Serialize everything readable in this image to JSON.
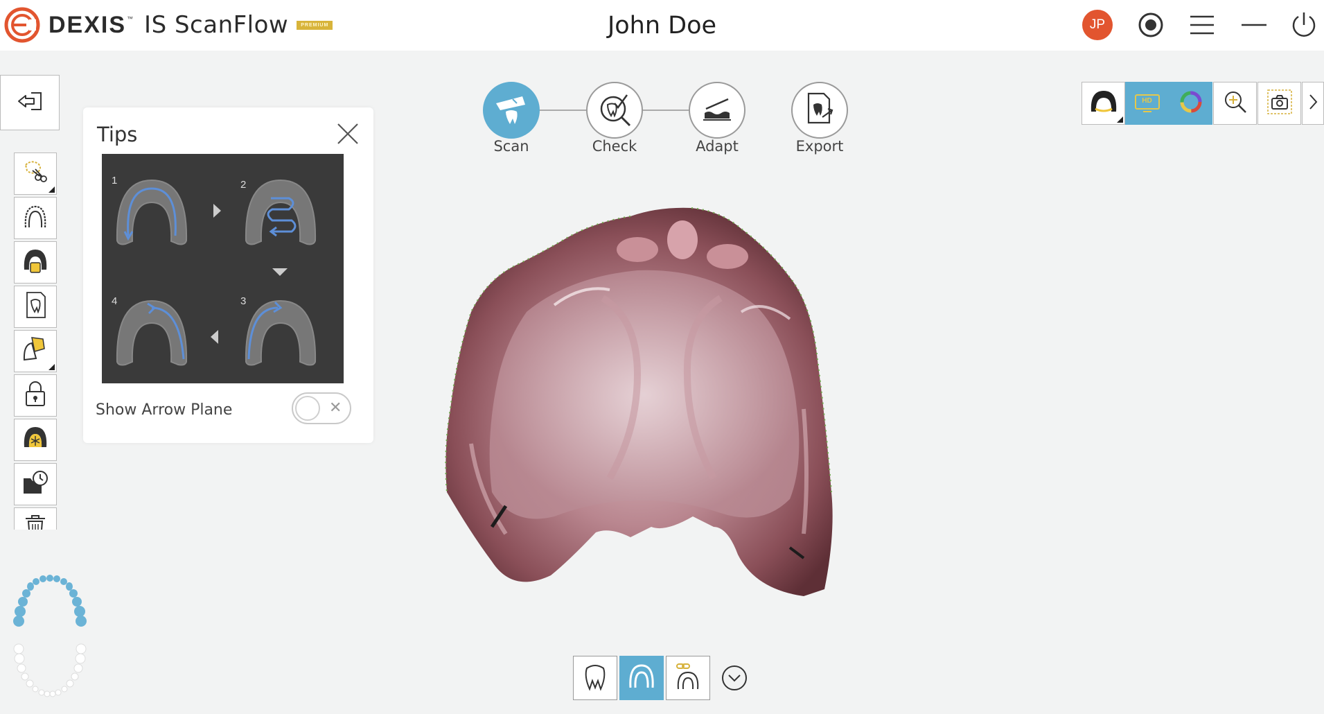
{
  "header": {
    "brand": "DEXIS",
    "trademark": "™",
    "product": "IS ScanFlow",
    "premium_badge": "PREMIUM",
    "patient_name": "John Doe",
    "user_initials": "JP",
    "icons": [
      "record-icon",
      "menu-icon",
      "minimize-icon",
      "power-icon"
    ]
  },
  "tips": {
    "title": "Tips",
    "steps": [
      "1",
      "2",
      "3",
      "4"
    ],
    "toggle_label": "Show Arrow Plane",
    "toggle_state": "off"
  },
  "workflow": {
    "active": "Scan",
    "steps": [
      {
        "label": "Scan",
        "icon": "scan-icon"
      },
      {
        "label": "Check",
        "icon": "check-icon"
      },
      {
        "label": "Adapt",
        "icon": "adapt-icon"
      },
      {
        "label": "Export",
        "icon": "export-icon"
      }
    ]
  },
  "left_tools": [
    "exit-icon",
    "trim-icon",
    "arch-icon",
    "bite-icon",
    "tooth-icon",
    "brush-icon",
    "lock-icon",
    "palate-icon",
    "history-icon",
    "delete-icon"
  ],
  "right_tools": {
    "items": [
      "jaw-view-icon",
      "hd-icon",
      "color-icon",
      "zoom-icon",
      "screenshot-icon",
      "chevron-right-icon"
    ],
    "hd_label": "HD"
  },
  "bottom_tools": {
    "items": [
      "tooth-icon",
      "upper-jaw-icon",
      "bite-link-icon",
      "chevron-down-icon"
    ],
    "active": "upper-jaw-icon"
  },
  "colors": {
    "accent": "#5eadd1",
    "avatar": "#e2552f",
    "logo": "#e2552f",
    "premium": "#d8b43a"
  }
}
